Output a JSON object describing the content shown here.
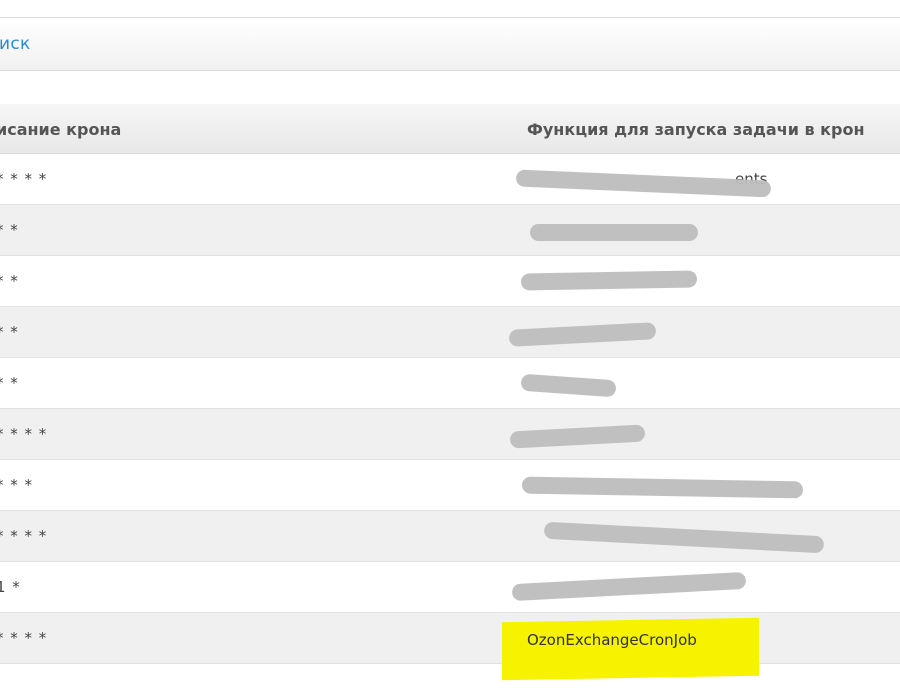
{
  "search": {
    "label": "иск"
  },
  "table": {
    "headers": [
      "исание крона",
      "Функция для запуска задачи в крон"
    ],
    "rows": [
      {
        "cron": "* * * *",
        "function": "ents"
      },
      {
        "cron": "* *",
        "function": ""
      },
      {
        "cron": "* *",
        "function": ""
      },
      {
        "cron": "* *",
        "function": ""
      },
      {
        "cron": "* *",
        "function": ""
      },
      {
        "cron": "* * * *",
        "function": ""
      },
      {
        "cron": "* * *",
        "function": ""
      },
      {
        "cron": "* * * *",
        "function": ""
      },
      {
        "cron": "1 *",
        "function": ""
      },
      {
        "cron": "* * * *",
        "function": "OzonExchangeCronJob"
      }
    ]
  },
  "colors": {
    "link": "#2a8ccf",
    "highlight": "#f7f200",
    "redaction": "#bdbdbd"
  }
}
